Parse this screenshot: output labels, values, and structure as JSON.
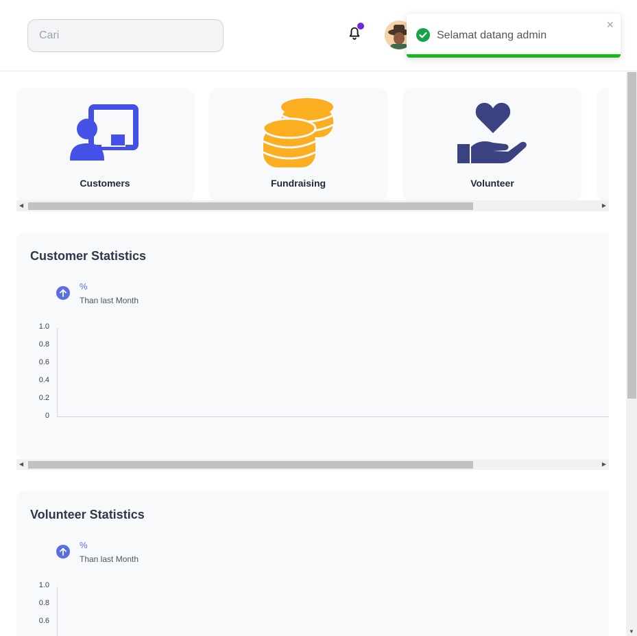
{
  "search": {
    "placeholder": "Cari"
  },
  "toast": {
    "message": "Selamat datang admin",
    "close": "×"
  },
  "cards": [
    {
      "label": "Customers",
      "icon": "customer-board-icon",
      "color": "#4550e6"
    },
    {
      "label": "Fundraising",
      "icon": "coins-icon",
      "color": "#fbae20"
    },
    {
      "label": "Volunteer",
      "icon": "heart-hand-icon",
      "color": "#3b4282"
    }
  ],
  "customer_stats": {
    "title": "Customer Statistics",
    "change": "%",
    "change_caption": "Than last Month",
    "y_ticks": [
      "1.0",
      "0.8",
      "0.6",
      "0.4",
      "0.2",
      "0"
    ]
  },
  "volunteer_stats": {
    "title": "Volunteer Statistics",
    "change": "%",
    "change_caption": "Than last Month",
    "y_ticks": [
      "1.0",
      "0.8",
      "0.6"
    ]
  },
  "colors": {
    "accent": "#5b6ee1",
    "success": "#1fb51f",
    "notification": "#6d28d9"
  }
}
